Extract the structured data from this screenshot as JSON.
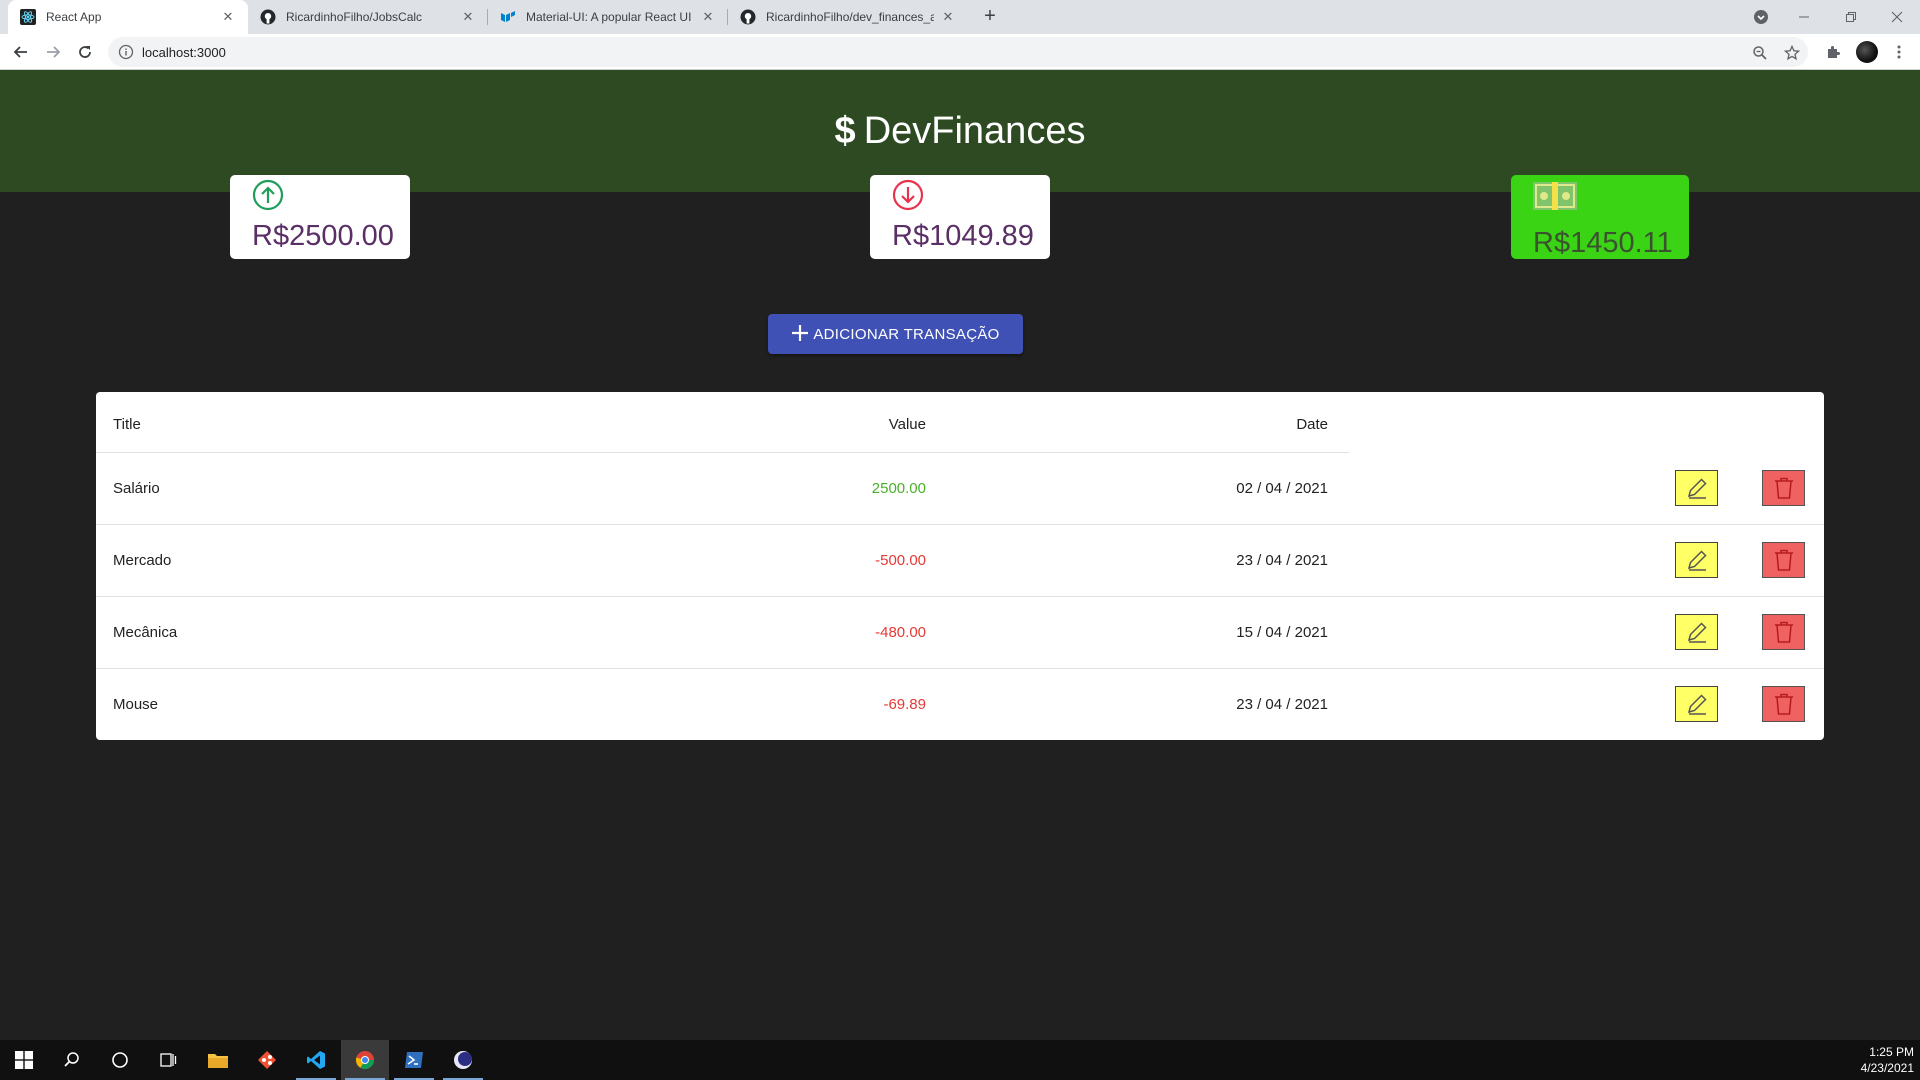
{
  "browser": {
    "tabs": [
      {
        "title": "React App",
        "active": true
      },
      {
        "title": "RicardinhoFilho/JobsCalc",
        "active": false
      },
      {
        "title": "Material-UI: A popular React UI f",
        "active": false
      },
      {
        "title": "RicardinhoFilho/dev_finances_api",
        "active": false
      }
    ],
    "new_tab_label": "+",
    "url": "localhost:3000"
  },
  "app": {
    "brand": {
      "symbol": "$",
      "name": "DevFinances"
    },
    "cards": {
      "income": {
        "icon": "arrow-up-circle-icon",
        "amount": "R$2500.00",
        "color": "#1e9e5a"
      },
      "expense": {
        "icon": "arrow-down-circle-icon",
        "amount": "R$1049.89",
        "color": "#e8334e"
      },
      "total": {
        "icon": "money-icon",
        "amount": "R$1450.11",
        "color": "#3bd414"
      }
    },
    "add_button": {
      "icon": "plus-icon",
      "label": "ADICIONAR TRANSAÇÃO"
    },
    "table": {
      "headers": {
        "title": "Title",
        "value": "Value",
        "date": "Date"
      },
      "rows": [
        {
          "title": "Salário",
          "value": "2500.00",
          "date": "02 / 04 / 2021",
          "type": "income"
        },
        {
          "title": "Mercado",
          "value": "-500.00",
          "date": "23 / 04 / 2021",
          "type": "expense"
        },
        {
          "title": "Mecânica",
          "value": "-480.00",
          "date": "15 / 04 / 2021",
          "type": "expense"
        },
        {
          "title": "Mouse",
          "value": "-69.89",
          "date": "23 / 04 / 2021",
          "type": "expense"
        }
      ],
      "income_color": "#4caf2a",
      "expense_color": "#e53935"
    }
  },
  "taskbar": {
    "time": "1:25 PM",
    "date": "4/23/2021"
  }
}
